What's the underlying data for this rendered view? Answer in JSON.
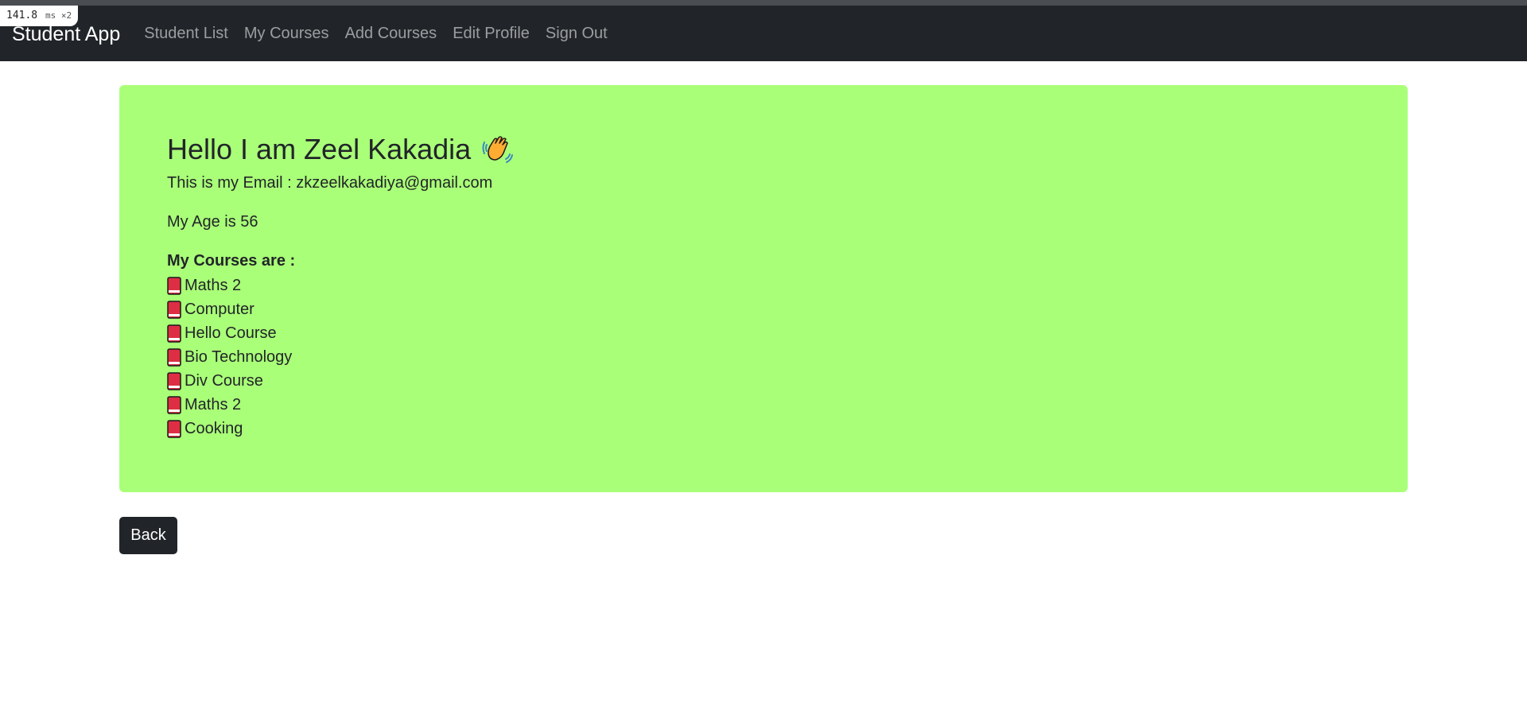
{
  "perf": {
    "value": "141.8",
    "unit": "ms ×2"
  },
  "navbar": {
    "brand": "Student App",
    "links": [
      "Student List",
      "My Courses",
      "Add Courses",
      "Edit Profile",
      "Sign Out"
    ]
  },
  "profile": {
    "greeting": "Hello I am Zeel Kakadia",
    "greeting_icon": "waving-hand-icon",
    "email_line": "This is my Email : zkzeelkakadiya@gmail.com",
    "age_line": "My Age is 56",
    "courses_title": "My Courses are :",
    "course_icon": "book-icon",
    "courses": [
      "Maths 2",
      "Computer",
      "Hello Course",
      "Bio Technology",
      "Div Course",
      "Maths 2",
      "Cooking"
    ]
  },
  "actions": {
    "back_label": "Back"
  },
  "colors": {
    "navbar_bg": "#212529",
    "card_bg": "#aaff78",
    "button_bg": "#212529"
  }
}
